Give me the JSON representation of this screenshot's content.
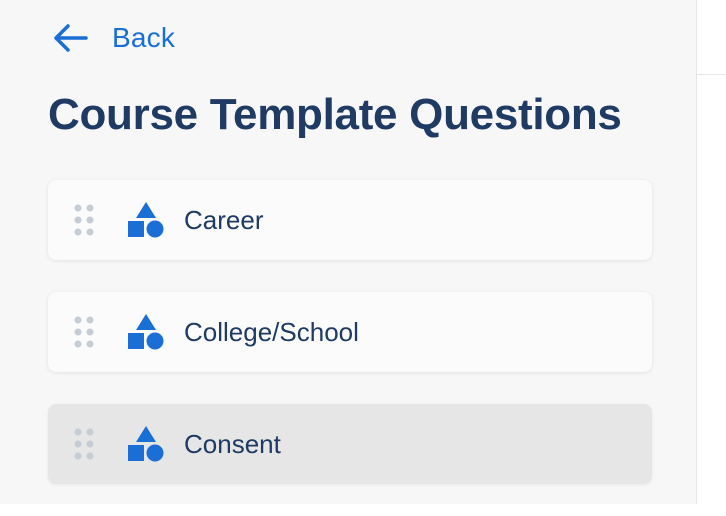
{
  "nav": {
    "back_label": "Back",
    "back_icon": "arrow-left-icon"
  },
  "page": {
    "title": "Course Template Questions"
  },
  "questions": [
    {
      "label": "Career",
      "icon": "shapes-icon",
      "selected": false
    },
    {
      "label": "College/School",
      "icon": "shapes-icon",
      "selected": false
    },
    {
      "label": "Consent",
      "icon": "shapes-icon",
      "selected": true
    }
  ],
  "colors": {
    "accent": "#1a6fd6",
    "title": "#1f3a63",
    "handle": "#c5ccd3",
    "selected_bg": "#e6e6e6"
  }
}
